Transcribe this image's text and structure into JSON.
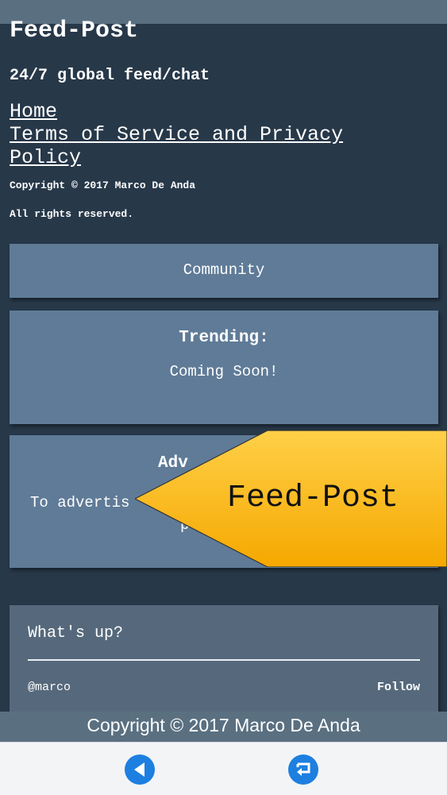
{
  "header": {
    "brand": "Feed-Post",
    "tagline": "24/7 global feed/chat"
  },
  "nav": {
    "home": "Home",
    "terms": "Terms of Service and Privacy Policy"
  },
  "legal": {
    "copyright": "Copyright © 2017 Marco De Anda",
    "rights": "All rights reserved."
  },
  "community": {
    "label": "Community"
  },
  "trending": {
    "title": "Trending:",
    "body": "Coming Soon!"
  },
  "advertise": {
    "title_visible": "Adv",
    "body_visible": "To advertis",
    "line2_visible": "p"
  },
  "compose": {
    "placeholder": "What's up?",
    "username": "@marco",
    "follow_label": "Follow"
  },
  "footer": {
    "text": "Copyright © 2017 Marco De Anda"
  },
  "banner": {
    "text": "Feed-Post"
  },
  "colors": {
    "background": "#273849",
    "card": "#5f7b97",
    "accent": "#1d7fe0",
    "banner": "#ffc21a"
  },
  "bottom_nav": {
    "icons": [
      "back-arrow-icon",
      "return-icon"
    ]
  }
}
